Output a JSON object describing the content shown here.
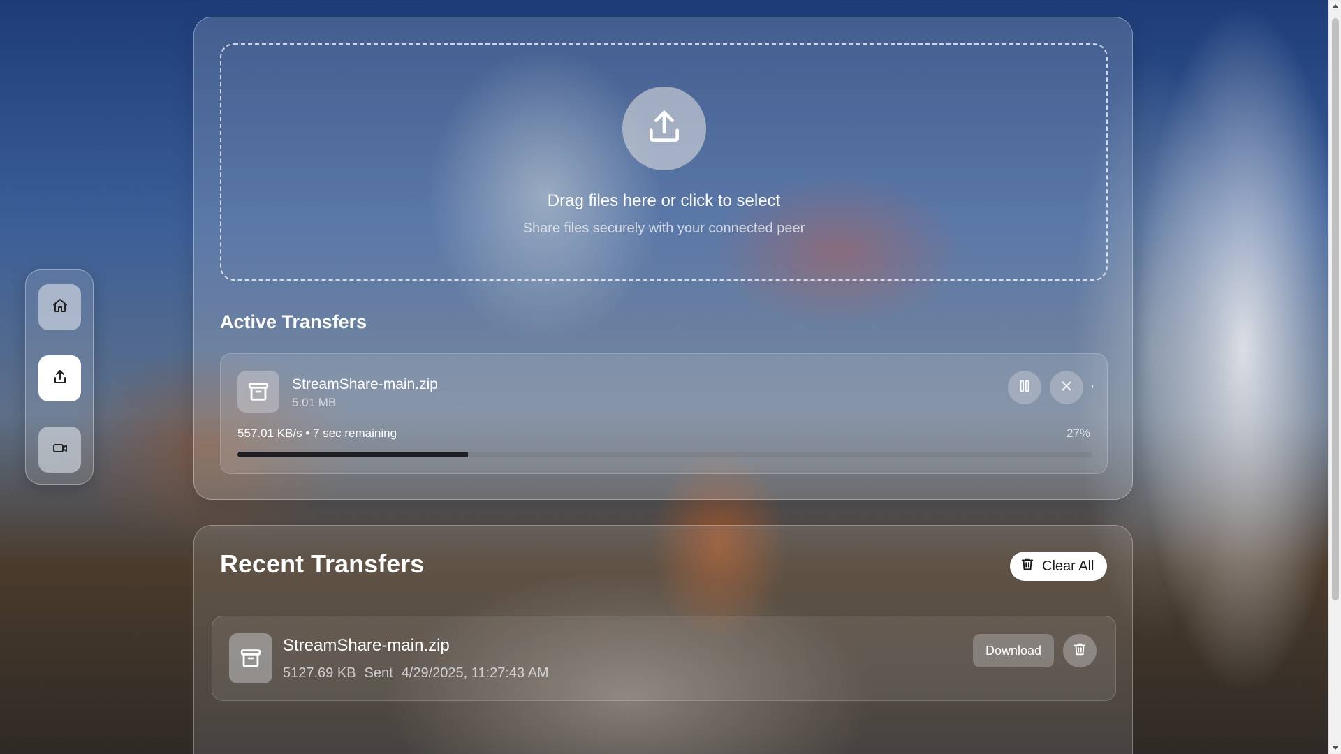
{
  "sidebar": {
    "items": [
      {
        "name": "home",
        "icon": "home-icon",
        "active": false
      },
      {
        "name": "share",
        "icon": "share-icon",
        "active": true
      },
      {
        "name": "video",
        "icon": "video-icon",
        "active": false
      }
    ]
  },
  "dropzone": {
    "title": "Drag files here or click to select",
    "subtitle": "Share files securely with your connected peer",
    "icon": "upload-icon"
  },
  "active_transfers": {
    "heading": "Active Transfers",
    "item": {
      "file_name": "StreamShare-main.zip",
      "file_size": "5.01 MB",
      "status": "557.01 KB/s • 7 sec remaining",
      "percent_label": "27%",
      "progress": 0.27,
      "extra_mark": ","
    }
  },
  "recent_transfers": {
    "heading": "Recent Transfers",
    "clear_label": "Clear All",
    "items": [
      {
        "file_name": "StreamShare-main.zip",
        "size": "5127.69 KB",
        "direction": "Sent",
        "timestamp": "4/29/2025, 11:27:43 AM",
        "download_label": "Download"
      }
    ]
  }
}
